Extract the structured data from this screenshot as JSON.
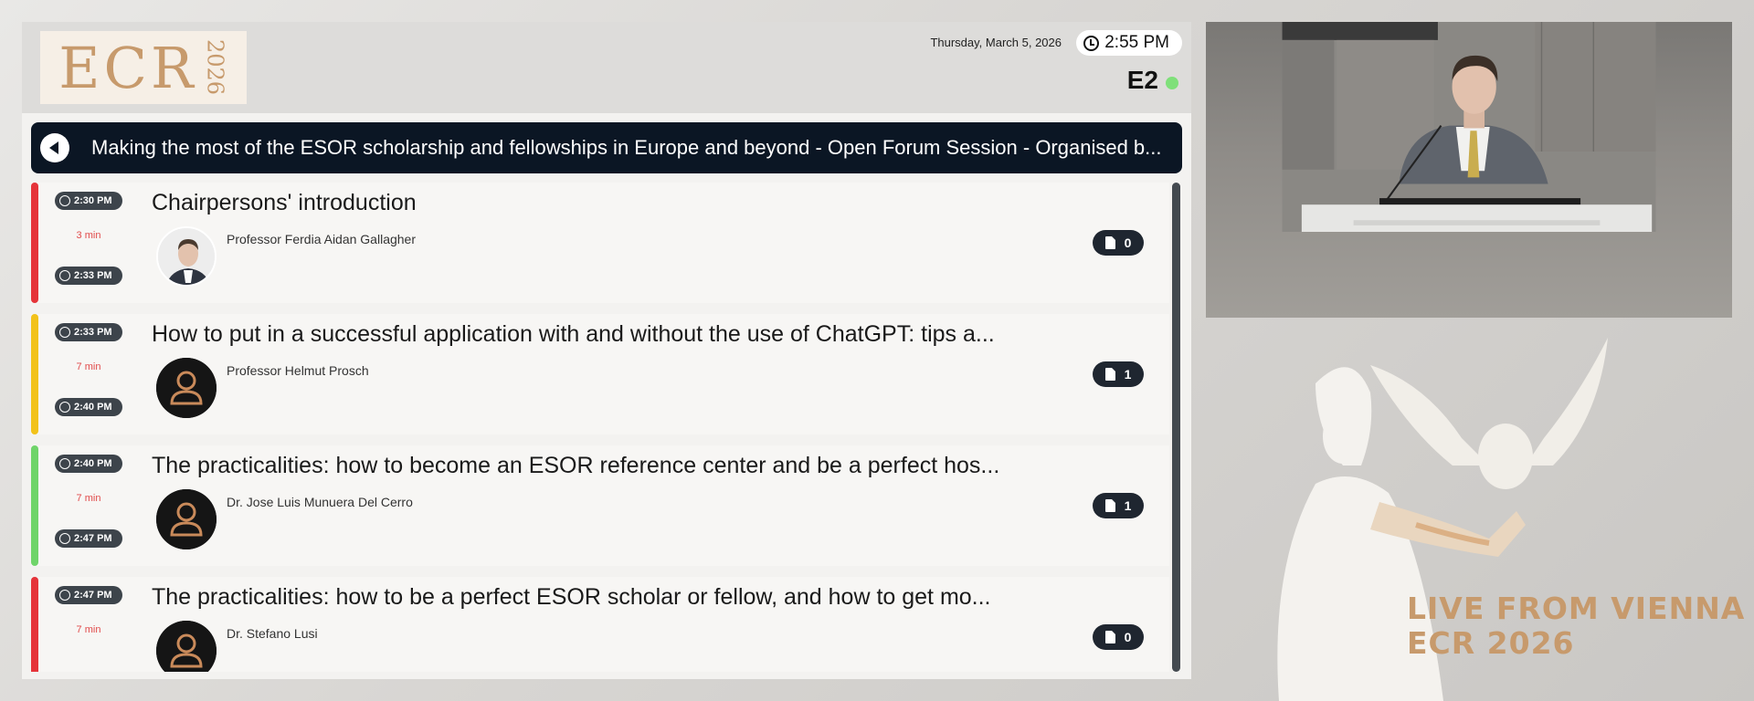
{
  "header": {
    "logo_text": "ECR",
    "logo_year": "2026",
    "date": "Thursday, March 5, 2026",
    "time": "2:55 PM",
    "room": "E2",
    "room_status_color": "#7fe07a"
  },
  "session": {
    "title": "Making the most of the ESOR scholarship and fellowships in Europe and beyond - Open Forum Session - Organised b..."
  },
  "talks": [
    {
      "start": "2:30 PM",
      "duration": "3 min",
      "end": "2:33 PM",
      "title": "Chairpersons' introduction",
      "speaker": "Professor Ferdia Aidan Gallagher",
      "documents": "0",
      "bar_color": "#e5343a",
      "avatar": "photo"
    },
    {
      "start": "2:33 PM",
      "duration": "7 min",
      "end": "2:40 PM",
      "title": "How to put in a successful application with and without the use of ChatGPT: tips a...",
      "speaker": "Professor Helmut Prosch",
      "documents": "1",
      "bar_color": "#f2c21a",
      "avatar": "placeholder"
    },
    {
      "start": "2:40 PM",
      "duration": "7 min",
      "end": "2:47 PM",
      "title": "The practicalities: how to become an ESOR reference center and be a perfect hos...",
      "speaker": "Dr. Jose Luis Munuera Del Cerro",
      "documents": "1",
      "bar_color": "#6fd46a",
      "avatar": "placeholder"
    },
    {
      "start": "2:47 PM",
      "duration": "7 min",
      "end": "",
      "title": "The practicalities: how to be a perfect ESOR scholar or fellow, and how to get mo...",
      "speaker": "Dr. Stefano Lusi",
      "documents": "0",
      "bar_color": "#e5343a",
      "avatar": "placeholder"
    }
  ],
  "branding": {
    "line1": "LIVE FROM VIENNA",
    "line2": "ECR 2026",
    "accent": "#c79a6c"
  }
}
